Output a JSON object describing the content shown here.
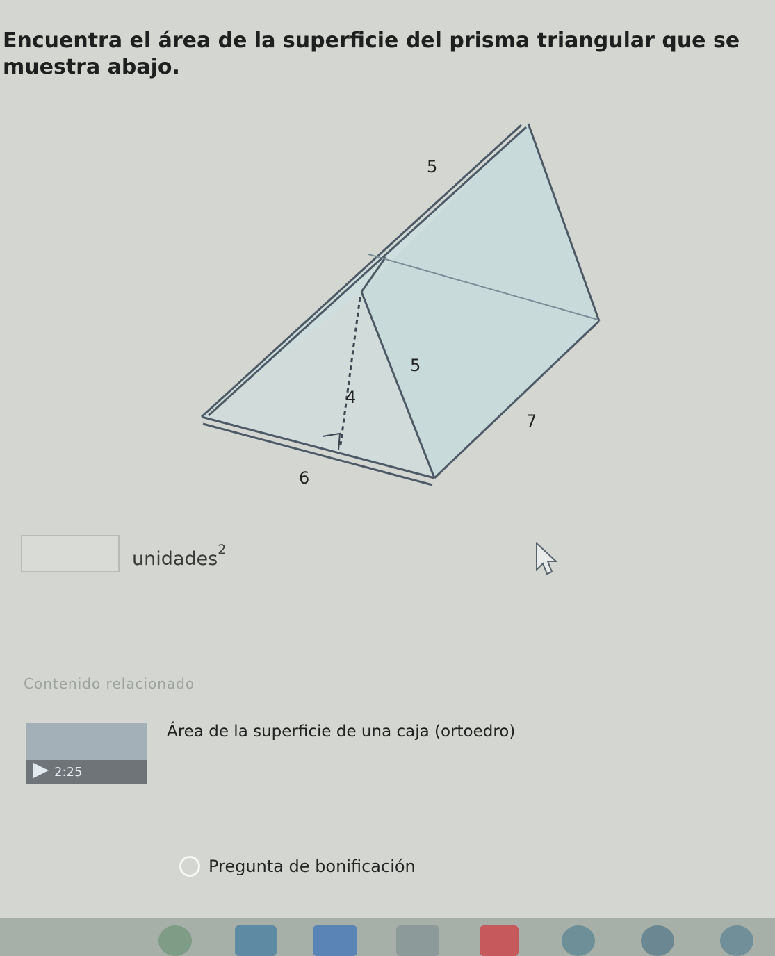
{
  "question": {
    "text": "Encuentra el área de la superficie del prisma triangular que se muestra abajo."
  },
  "figure": {
    "label_top_edge": "5",
    "label_slant": "5",
    "label_height": "4",
    "label_base": "6",
    "label_length": "7"
  },
  "answer": {
    "value": "",
    "units": "unidades",
    "exponent": "2"
  },
  "related": {
    "title": "Contenido relacionado",
    "video": {
      "title": "Área de la superficie de una caja (ortoedro)",
      "duration": "2:25"
    }
  },
  "bonus": {
    "label": "Pregunta de bonificación"
  },
  "colors": {
    "background": "#d4d7d1",
    "prism_line": "#4d5a66",
    "prism_face": "#c9dcdc"
  }
}
